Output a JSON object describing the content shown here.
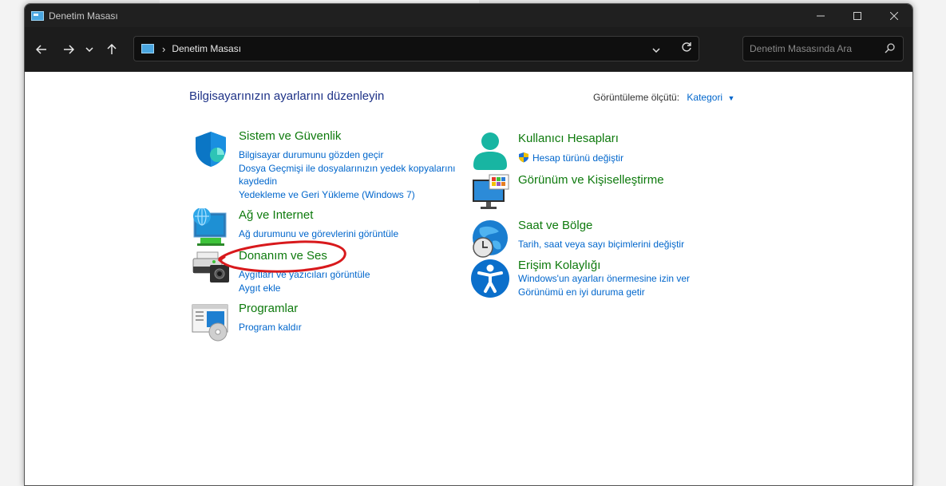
{
  "window": {
    "title": "Denetim Masası"
  },
  "nav": {
    "back_icon": "arrow-left-icon",
    "forward_icon": "arrow-right-icon",
    "recent_icon": "chevron-down-icon",
    "up_icon": "arrow-up-icon"
  },
  "address": {
    "crumb": "Denetim Masası"
  },
  "search": {
    "placeholder": "Denetim Masasında Ara"
  },
  "main": {
    "heading": "Bilgisayarınızın ayarlarını düzenleyin",
    "view_by_label": "Görüntüleme ölçütü:",
    "view_by_value": "Kategori"
  },
  "categories_left": [
    {
      "title": "Sistem ve Güvenlik",
      "links": [
        "Bilgisayar durumunu gözden geçir",
        "Dosya Geçmişi ile dosyalarınızın yedek kopyalarını",
        "kaydedin",
        "Yedekleme ve Geri Yükleme (Windows 7)"
      ]
    },
    {
      "title": "Ağ ve Internet",
      "links": [
        "Ağ durumunu ve görevlerini görüntüle"
      ]
    },
    {
      "title": "Donanım ve Ses",
      "links": [
        "Aygıtları ve yazıcıları görüntüle",
        "Aygıt ekle"
      ]
    },
    {
      "title": "Programlar",
      "links": [
        "Program kaldır"
      ]
    }
  ],
  "categories_right": [
    {
      "title": "Kullanıcı Hesapları",
      "links": [
        "Hesap türünü değiştir"
      ]
    },
    {
      "title": "Görünüm ve Kişiselleştirme",
      "links": []
    },
    {
      "title": "Saat ve Bölge",
      "links": [
        "Tarih, saat veya sayı biçimlerini değiştir"
      ]
    },
    {
      "title": "Erişim Kolaylığı",
      "links": [
        "Windows'un ayarları önermesine izin ver",
        "Görünümü en iyi duruma getir"
      ]
    }
  ],
  "colors": {
    "category_title": "#0e7a0d",
    "link": "#0066cc",
    "heading": "#1e3287",
    "annotation": "#d8191c"
  }
}
